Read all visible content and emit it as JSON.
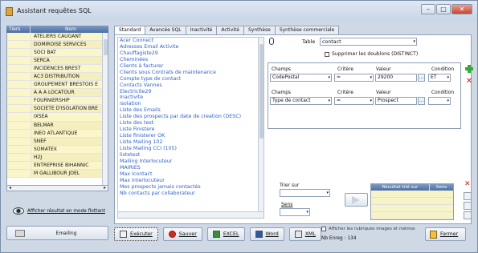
{
  "window": {
    "title": "Assistant requêtes SQL",
    "buttons": {
      "minimize": "–",
      "maximize": "□",
      "close": "✕"
    }
  },
  "left_panel": {
    "header": {
      "col1": "Tiers",
      "col2": "Nom"
    },
    "rows": [
      "ATELIERS CAUGANT",
      "DOMIROISE SERVICES",
      "SOCI BAT",
      "SERCA",
      "INCIDENCES BREST",
      "AC3 DISTRIBUTION",
      "GROUPEMENT BRESTOIS E",
      "A A A LOCATOUR",
      "FOURNIERSHIP",
      "SOCIETE D'ISOLATION BRE",
      "IXSEA",
      "BELMAR",
      "INEO ATLANTIQUE",
      "SNEF",
      "SOMATEX",
      "H2J",
      "ENTREPRISE BIHANNIC",
      "M GALLIBOUR JOEL"
    ],
    "flottant_label": "Afficher résultat en mode flottant",
    "emailing_label": "Emailing"
  },
  "tabs": [
    "Standard",
    "Avancée SQL",
    "Inactivité",
    "Activité",
    "Synthèse",
    "Synthèse commerciale"
  ],
  "query_list": [
    "Acer Connect",
    "Adresses Email Activite",
    "Chauffagiste29",
    "Cheminées",
    "Clients à facturer",
    "Clients sous Contrats de maintenance",
    "Compte type de contact",
    "Contacts Vannes",
    "Electricite29",
    "Inactivite",
    "isolation",
    "Liste des Emails",
    "Liste des prospects par date de creation (DESC)",
    "Liste des test",
    "Liste Finistere",
    "Liste finisterer OK",
    "Liste Mailing 102",
    "Liste Mailing CCI (105)",
    "listetest",
    "Mailing Interlocuteur",
    "MAIRIES",
    "Max Icontact",
    "Max Interlocuteur",
    "Mes prospects jamais contactés",
    "Nb contacts par collaborateur"
  ],
  "table": {
    "label": "Table",
    "value": "contact"
  },
  "distinct_label": "Supprimer les doublons (DISTINCT)",
  "criteria": {
    "headers": {
      "champs": "Champs",
      "critere": "Critère",
      "valeur": "Valeur",
      "condition": "Condition"
    },
    "rows": [
      {
        "champ": "CodePostal",
        "critere": "=",
        "valeur": "29200",
        "condition": "ET"
      },
      {
        "champ": "Type de contact",
        "critere": "=",
        "valeur": "Prospect",
        "condition": ""
      }
    ],
    "ellipsis": "..."
  },
  "sort": {
    "trier_label": "Trier sur",
    "sens_label": "Sens",
    "headers": {
      "result": "Résultat trié sur",
      "sens": "Sens"
    }
  },
  "bottom_buttons": {
    "executer": "Exécuter",
    "sauver": "Sauver",
    "excel": "EXCEL",
    "word": "Word",
    "xml": "XML"
  },
  "afficher_rubriques": "Afficher les rubriques images et mémos",
  "nb_enreg": "Nb Enreg : 134",
  "fermer": "Fermer",
  "scroll_arrows": {
    "left": "◂",
    "right": "▸",
    "down": "▾"
  }
}
